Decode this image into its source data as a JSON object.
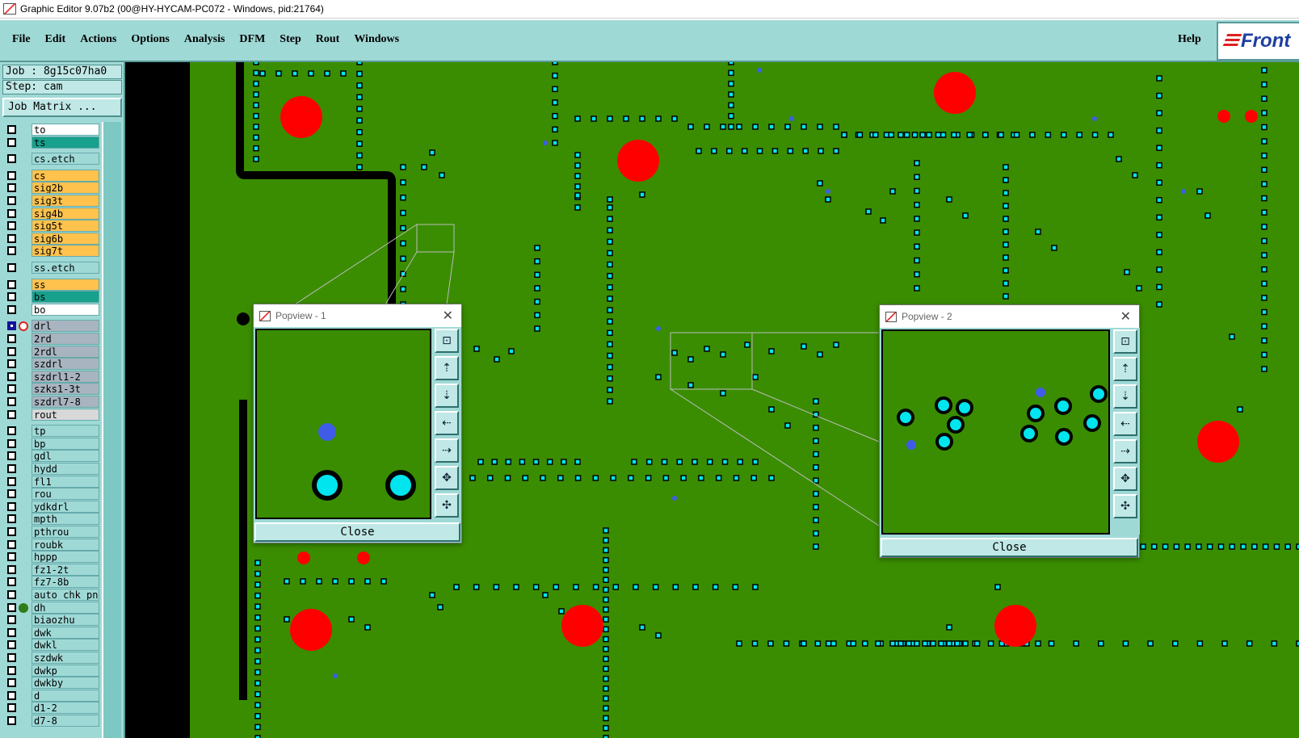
{
  "window": {
    "title": "Graphic Editor 9.07b2 (00@HY-HYCAM-PC072 - Windows, pid:21764)"
  },
  "menubar": {
    "items": [
      "File",
      "Edit",
      "Actions",
      "Options",
      "Analysis",
      "DFM",
      "Step",
      "Rout",
      "Windows"
    ],
    "help": "Help",
    "logo": "Front"
  },
  "job": {
    "label": "Job : 8g15c07ha0",
    "step": "Step: cam",
    "matrix_button": "Job Matrix ..."
  },
  "layers": [
    {
      "name": "to",
      "color": "#ffffff"
    },
    {
      "name": "ts",
      "color": "#17a08c"
    },
    {
      "name": "cs.etch",
      "color": "#9fd9d6",
      "gap": true
    },
    {
      "name": "cs",
      "color": "#ffc24d",
      "gap": true
    },
    {
      "name": "sig2b",
      "color": "#ffc24d"
    },
    {
      "name": "sig3t",
      "color": "#ffc24d"
    },
    {
      "name": "sig4b",
      "color": "#ffc24d"
    },
    {
      "name": "sig5t",
      "color": "#ffc24d"
    },
    {
      "name": "sig6b",
      "color": "#ffc24d"
    },
    {
      "name": "sig7t",
      "color": "#ffc24d"
    },
    {
      "name": "ss.etch",
      "color": "#9fd9d6",
      "gap": true
    },
    {
      "name": "ss",
      "color": "#ffc24d",
      "gap": true
    },
    {
      "name": "bs",
      "color": "#17a08c"
    },
    {
      "name": "bo",
      "color": "#ffffff"
    },
    {
      "name": "drl",
      "color": "#a8b4bf",
      "gap": true,
      "active": true
    },
    {
      "name": "2rd",
      "color": "#a8b4bf"
    },
    {
      "name": "2rdl",
      "color": "#a8b4bf"
    },
    {
      "name": "szdrl",
      "color": "#a8b4bf"
    },
    {
      "name": "szdrl1-2",
      "color": "#a8b4bf"
    },
    {
      "name": "szks1-3t",
      "color": "#a8b4bf"
    },
    {
      "name": "szdrl7-8",
      "color": "#a8b4bf"
    },
    {
      "name": "rout",
      "color": "#d8d8d8"
    },
    {
      "name": "tp",
      "color": "#9fd9d6",
      "gap": true
    },
    {
      "name": "bp",
      "color": "#9fd9d6"
    },
    {
      "name": "gdl",
      "color": "#9fd9d6"
    },
    {
      "name": "hydd",
      "color": "#9fd9d6"
    },
    {
      "name": "fl1",
      "color": "#9fd9d6"
    },
    {
      "name": "rou",
      "color": "#9fd9d6"
    },
    {
      "name": "ydkdrl",
      "color": "#9fd9d6"
    },
    {
      "name": "mpth",
      "color": "#9fd9d6"
    },
    {
      "name": "pthrou",
      "color": "#9fd9d6"
    },
    {
      "name": "roubk",
      "color": "#9fd9d6"
    },
    {
      "name": "hppp",
      "color": "#9fd9d6"
    },
    {
      "name": "fz1-2t",
      "color": "#9fd9d6"
    },
    {
      "name": "fz7-8b",
      "color": "#9fd9d6"
    },
    {
      "name": "auto_chk_pn",
      "color": "#9fd9d6"
    },
    {
      "name": "dh",
      "color": "#9fd9d6",
      "dot": "#2e7d1a"
    },
    {
      "name": "biaozhu",
      "color": "#9fd9d6"
    },
    {
      "name": "dwk",
      "color": "#9fd9d6"
    },
    {
      "name": "dwkl",
      "color": "#9fd9d6"
    },
    {
      "name": "szdwk",
      "color": "#9fd9d6"
    },
    {
      "name": "dwkp",
      "color": "#9fd9d6"
    },
    {
      "name": "dwkby",
      "color": "#9fd9d6"
    },
    {
      "name": "d",
      "color": "#9fd9d6"
    },
    {
      "name": "d1-2",
      "color": "#9fd9d6"
    },
    {
      "name": "d7-8",
      "color": "#9fd9d6"
    }
  ],
  "popview1": {
    "title": "Popview - 1",
    "close": "Close"
  },
  "popview2": {
    "title": "Popview - 2",
    "close": "Close"
  },
  "colors": {
    "board": "#3a8d00",
    "pad": "#ff0000",
    "via": "#00e5ee",
    "panel": "#9fd9d6",
    "accent": "#1d3f9e"
  }
}
